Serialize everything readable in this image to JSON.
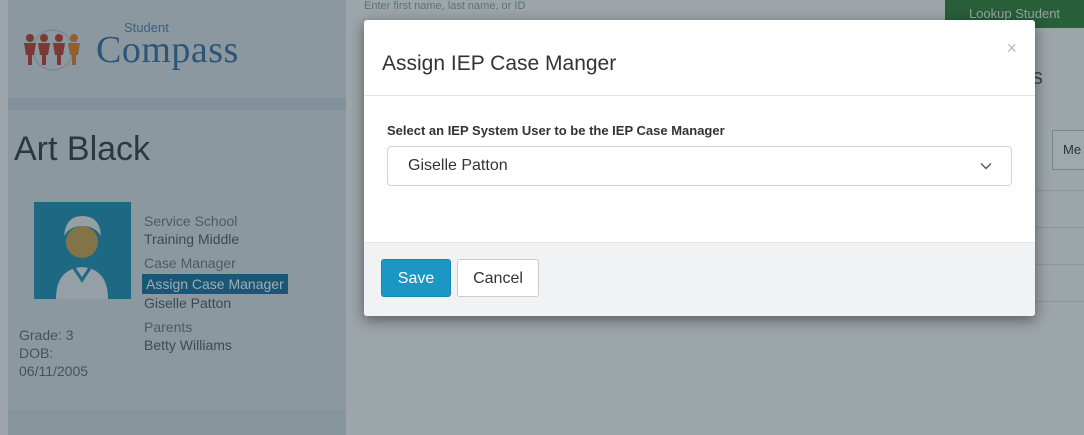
{
  "background": {
    "logo": {
      "small_text": "Student",
      "big_text": "Compass"
    },
    "top_search_placeholder": "Enter first name, last name, or ID",
    "lookup_button": "Lookup Student",
    "right_tab_fragment": "Me",
    "right_header_fragment": "s",
    "student": {
      "name": "Art Black",
      "service_school_label": "Service School",
      "service_school_value": "Training Middle",
      "case_manager_label": "Case Manager",
      "assign_case_manager_link": "Assign Case Manager",
      "case_manager_value": "Giselle Patton",
      "parents_label": "Parents",
      "parents_value": "Betty Williams",
      "grade": "Grade: 3",
      "dob_label": "DOB:",
      "dob_value": "06/11/2005"
    }
  },
  "modal": {
    "title": "Assign IEP Case Manger",
    "close_symbol": "×",
    "field_label": "Select an IEP System User to be the IEP Case Manager",
    "selected_user": "Giselle Patton",
    "save_label": "Save",
    "cancel_label": "Cancel"
  },
  "colors": {
    "primary_button": "#1a97c4",
    "assign_link": "#1173a1",
    "photo_bg": "#1a8fb3",
    "lookup_button": "#2e7d32"
  },
  "icons": {
    "close": "close-icon",
    "chevron": "chevron-down-icon",
    "avatar": "student-avatar-icon"
  }
}
